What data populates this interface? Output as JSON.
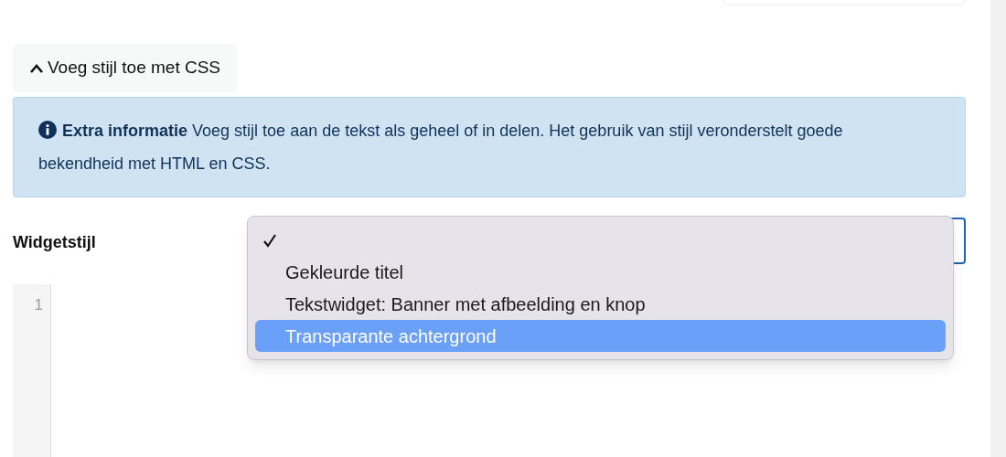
{
  "toggle": {
    "label": "Voeg stijl toe met CSS",
    "expanded": true
  },
  "info": {
    "title": "Extra informatie",
    "text": "Voeg stijl toe aan de tekst als geheel of in delen. Het gebruik van stijl veronderstelt goede bekendheid met HTML en CSS."
  },
  "widget_style": {
    "label": "Widgetstijl",
    "open": true,
    "options": [
      {
        "checked": true,
        "highlighted": false
      },
      {
        "label": "Gekleurde titel",
        "checked": false,
        "highlighted": false
      },
      {
        "label": "Tekstwidget: Banner met afbeelding en knop",
        "checked": false,
        "highlighted": false
      },
      {
        "label": "Transparante achtergrond",
        "checked": false,
        "highlighted": true
      }
    ]
  },
  "editor": {
    "line_numbers": [
      "1"
    ]
  }
}
